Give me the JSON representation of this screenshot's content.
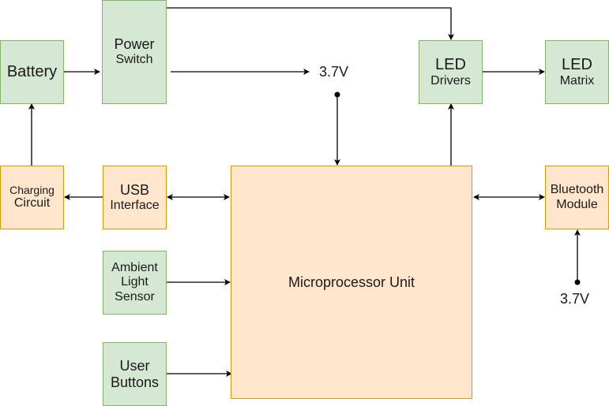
{
  "diagram": {
    "blocks": {
      "battery": {
        "line1": "Battery"
      },
      "power_switch": {
        "line1": "Power",
        "line2": "Switch"
      },
      "led_drivers": {
        "line1": "LED",
        "line2": "Drivers"
      },
      "led_matrix": {
        "line1": "LED",
        "line2": "Matrix"
      },
      "charging_circuit": {
        "line1": "Charging",
        "line2": "Circuit"
      },
      "usb_interface": {
        "line1": "USB",
        "line2": "Interface"
      },
      "microprocessor": {
        "line1": "Microprocessor Unit"
      },
      "bluetooth_module": {
        "line1": "Bluetooth",
        "line2": "Module"
      },
      "ambient_light_sensor": {
        "line1": "Ambient",
        "line2": "Light",
        "line3": "Sensor"
      },
      "user_buttons": {
        "line1": "User",
        "line2": "Buttons"
      }
    },
    "labels": {
      "voltage_top": "3.7V",
      "voltage_bluetooth": "3.7V"
    },
    "colors": {
      "green_fill": "#d5e8d4",
      "green_stroke": "#82b366",
      "orange_fill": "#ffe6cc",
      "orange_stroke": "#d79b00",
      "wire": "#000000"
    }
  }
}
